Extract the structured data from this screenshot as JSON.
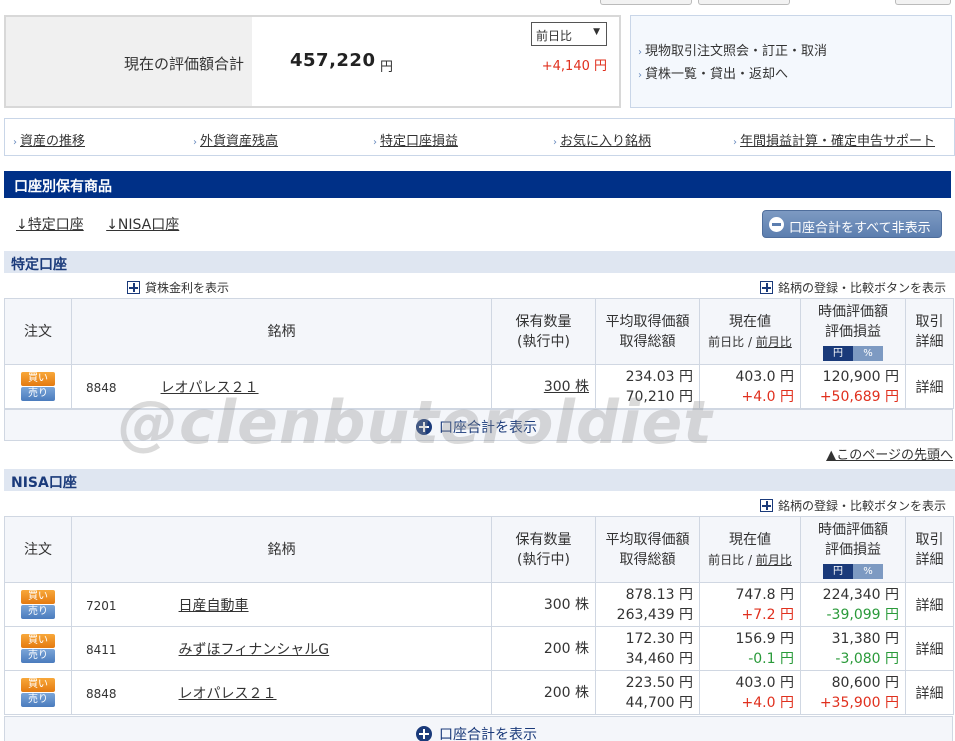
{
  "valuation": {
    "label": "現在の評価額合計",
    "amount": "457,220",
    "unit": "円",
    "compare_select": "前日比",
    "change": "+4,140 円"
  },
  "side_links": [
    "現物取引注文照会・訂正・取消",
    "貸株一覧・貸出・返却へ"
  ],
  "link_bar": [
    "資産の推移",
    "外貨資産残高",
    "特定口座損益",
    "お気に入り銘柄",
    "年間損益計算・確定申告サポート"
  ],
  "section_title": "口座別保有商品",
  "anchors": [
    "↓特定口座",
    "↓NISA口座"
  ],
  "hide_all_button": "口座合計をすべて非表示",
  "columns": {
    "order": "注文",
    "name": "銘柄",
    "qty": [
      "保有数量",
      "(執行中)"
    ],
    "avg": [
      "平均取得価額",
      "取得総額"
    ],
    "price": "現在値",
    "price_sub": "前日比 / 前月比",
    "price_sub_a": "前日比",
    "price_sub_b": "前月比",
    "value": [
      "時価評価額",
      "評価損益"
    ],
    "toggle": [
      "円",
      "%"
    ],
    "detail": [
      "取引",
      "詳細"
    ]
  },
  "buy_label": "買い",
  "sell_label": "売り",
  "detail_label": "詳細",
  "show_total": "口座合計を表示",
  "accounts": {
    "tokutei": {
      "title": "特定口座",
      "lending_link": "貸株金利を表示",
      "compare_link": "銘柄の登録・比較ボタンを表示",
      "rows": [
        {
          "code": "8848",
          "name": "レオパレス２１",
          "qty": "300 株",
          "avg": "234.03 円",
          "total": "70,210 円",
          "price": "403.0 円",
          "price_chg": "+4.0 円",
          "value": "120,900 円",
          "pl": "+50,689 円"
        }
      ]
    },
    "nisa": {
      "title": "NISA口座",
      "compare_link": "銘柄の登録・比較ボタンを表示",
      "rows": [
        {
          "code": "7201",
          "name": "日産自動車",
          "qty": "300 株",
          "avg": "878.13 円",
          "total": "263,439 円",
          "price": "747.8 円",
          "price_chg": "+7.2 円",
          "value": "224,340 円",
          "pl": "-39,099 円"
        },
        {
          "code": "8411",
          "name": "みずほフィナンシャルG",
          "qty": "200 株",
          "avg": "172.30 円",
          "total": "34,460 円",
          "price": "156.9 円",
          "price_chg": "-0.1 円",
          "value": "31,380 円",
          "pl": "-3,080 円"
        },
        {
          "code": "8848",
          "name": "レオパレス２１",
          "qty": "200 株",
          "avg": "223.50 円",
          "total": "44,700 円",
          "price": "403.0 円",
          "price_chg": "+4.0 円",
          "value": "80,600 円",
          "pl": "+35,900 円"
        }
      ]
    }
  },
  "page_top": "▲このページの先頭へ",
  "watermark": "@clenbuteroldiet"
}
